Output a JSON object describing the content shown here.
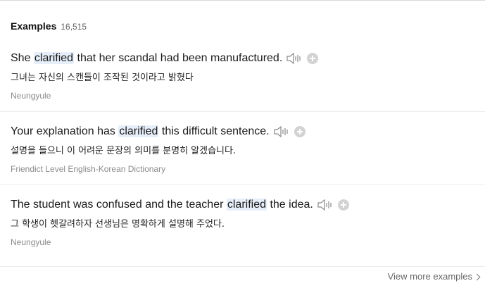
{
  "header": {
    "title": "Examples",
    "count": "16,515"
  },
  "examples": [
    {
      "before": "She ",
      "highlight": "clarified",
      "after": " that her scandal had been manufactured.",
      "translation": "그녀는 자신의 스캔들이 조작된 것이라고 밝혔다",
      "source": "Neungyule"
    },
    {
      "before": "Your explanation has ",
      "highlight": "clarified",
      "after": " this difficult sentence.",
      "translation": "설명을 들으니 이 어려운 문장의 의미를 분명히 알겠습니다.",
      "source": "Friendict Level English-Korean Dictionary"
    },
    {
      "before": "The student was confused and the teacher ",
      "highlight": "clarified",
      "after": " the idea.",
      "translation": "그 학생이 헷갈려하자 선생님은 명확하게 설명해 주었다.",
      "source": "Neungyule"
    }
  ],
  "footer": {
    "view_more_label": "View more examples"
  },
  "icons": {
    "speaker": "speaker-icon",
    "add": "plus-circle-icon",
    "chevron": "chevron-right-icon"
  }
}
